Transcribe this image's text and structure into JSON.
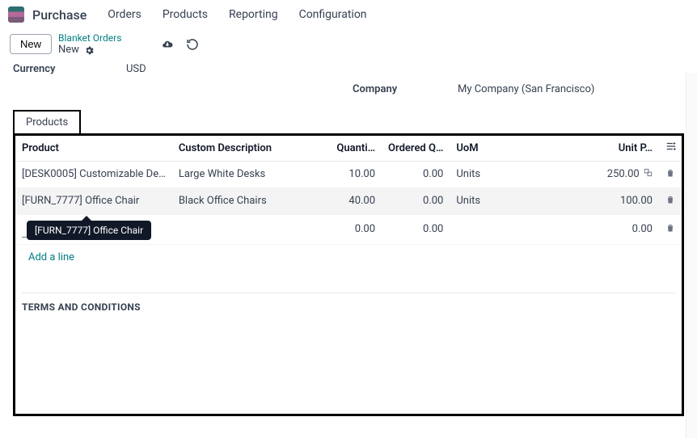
{
  "app": {
    "title": "Purchase"
  },
  "nav": {
    "items": [
      "Orders",
      "Products",
      "Reporting",
      "Configuration"
    ]
  },
  "ctrl": {
    "new_btn": "New",
    "breadcrumb_top": "Blanket Orders",
    "breadcrumb_state": "New"
  },
  "form": {
    "currency_label": "Currency",
    "currency_value": "USD",
    "company_label": "Company",
    "company_value": "My Company (San Francisco)"
  },
  "tab": {
    "products_label": "Products"
  },
  "table": {
    "headers": {
      "product": "Product",
      "desc": "Custom Description",
      "qty": "Quanti…",
      "ord": "Ordered Q…",
      "uom": "UoM",
      "unit": "Unit P…"
    },
    "rows": [
      {
        "product": "[DESK0005] Customizable De…",
        "desc": "Large White Desks",
        "qty": "10.00",
        "ord": "0.00",
        "uom": "Units",
        "unit": "250.00"
      },
      {
        "product": "[FURN_7777] Office Chair",
        "desc": "Black Office Chairs",
        "qty": "40.00",
        "ord": "0.00",
        "uom": "Units",
        "unit": "100.00"
      }
    ],
    "editing": {
      "tooltip_text": "[FURN_7777] Office Chair",
      "input_value": "",
      "qty": "0.00",
      "ord": "0.00",
      "unit": "0.00"
    },
    "add_line": "Add a line"
  },
  "terms": {
    "label": "TERMS AND CONDITIONS"
  }
}
